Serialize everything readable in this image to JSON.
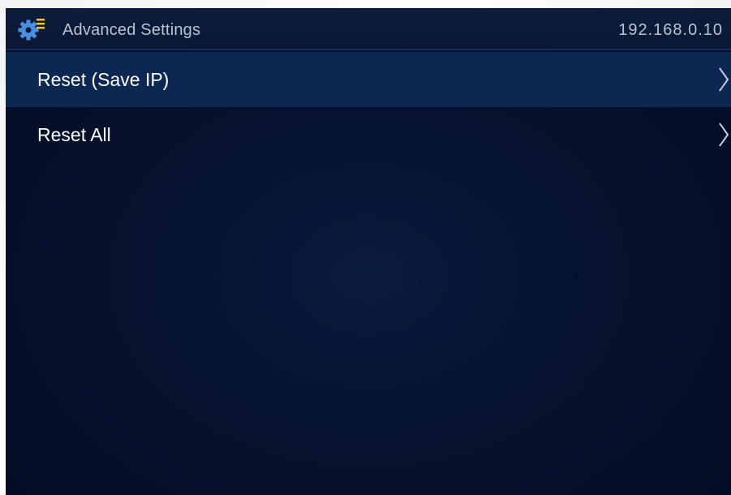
{
  "header": {
    "title": "Advanced Settings",
    "ip_address": "192.168.0.10",
    "icon": "gear-list-icon"
  },
  "menu": {
    "items": [
      {
        "label": "Reset (Save IP)",
        "selected": true,
        "icon": "chevron-right-icon"
      },
      {
        "label": "Reset All",
        "selected": false,
        "icon": "chevron-right-icon"
      }
    ]
  },
  "colors": {
    "background": "#06122f",
    "header_background": "#0a1834",
    "selected_row": "#0d2753",
    "gear_icon": "#4a8fe0",
    "list_lines": "#f5c21b",
    "text_primary": "#ffffff",
    "text_secondary": "#b9c2d3"
  }
}
